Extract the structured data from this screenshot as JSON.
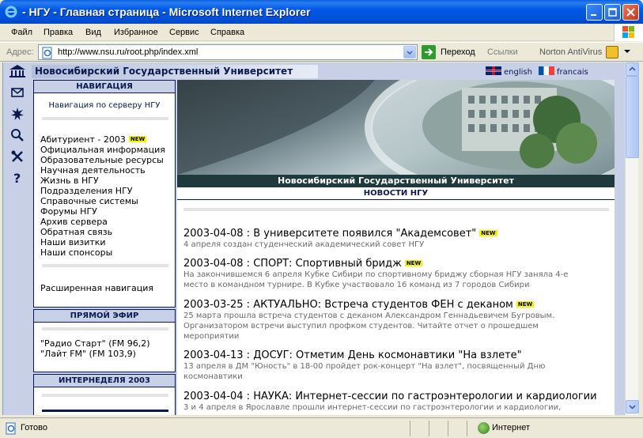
{
  "window": {
    "title": "- НГУ - Главная страница - Microsoft Internet Explorer"
  },
  "menu": [
    "Файл",
    "Правка",
    "Вид",
    "Избранное",
    "Сервис",
    "Справка"
  ],
  "address_bar": {
    "label": "Адрес:",
    "url": "http://www.nsu.ru/root.php/index.xml",
    "go_label": "Переход",
    "links_label": "Ссылки",
    "norton_label": "Norton AntiVirus"
  },
  "site": {
    "title": "Новосибирский Государственный Университет",
    "lang_en": "english",
    "lang_fr": "francais",
    "banner_caption": "Новосибирский Государственный Университет"
  },
  "left_icons": [
    "mail-icon",
    "star-icon",
    "search-icon",
    "tools-icon",
    "help-icon"
  ],
  "navigation": {
    "header": "НАВИГАЦИЯ",
    "subtitle": "Навигация по серверу НГУ",
    "new_badge": "NEW",
    "items": [
      "Абитуриент - 2003",
      "Официальная информация",
      "Образовательные ресурсы",
      "Научная деятельность",
      "Жизнь в НГУ",
      "Подразделения НГУ",
      "Справочные системы",
      "Форумы НГУ",
      "Архив сервера",
      "Обратная связь",
      "Наши визитки",
      "Наши спонсоры"
    ],
    "advanced": "Расширенная навигация"
  },
  "live": {
    "header": "ПРЯМОЙ ЭФИР",
    "items": [
      "\"Радио Старт\" (FM 96,2)",
      "\"Лайт FM\" (FM 103,9)"
    ]
  },
  "internet_week": {
    "header": "ИНТЕРНЕДЕЛЯ 2003"
  },
  "news": {
    "header": "НОВОСТИ НГУ",
    "items": [
      {
        "title": "2003-04-08 : В университете появился \"Академсовет\"",
        "text": "4 апреля создан студенческий академический совет НГУ"
      },
      {
        "title": "2003-04-08 : СПОРТ: Спортивный бридж",
        "text": "На закончившемся 6 апреля Кубке Сибири по спортивному бриджу сборная НГУ заняла 4-е место в командном турнире. В Кубке участвовало 16 команд из 7 городов Сибири"
      },
      {
        "title": "2003-03-25 : АКТУАЛЬНО: Встреча студентов ФЕН с деканом",
        "text": "25 марта прошла встреча студентов с деканом Александром Геннадьевичем Бугровым. Организатором встречи выступил профком студентов. Читайте отчет о прошедшем мероприятии"
      },
      {
        "title": "2003-04-13 : ДОСУГ: Отметим День космонавтики \"На взлете\"",
        "text": "13 апреля в ДМ \"Юность\" в 18-00 пройдет рок-концерт \"На взлет\", посвященный Дню космонавтики"
      },
      {
        "title": "2003-04-04 : НАУКА: Интернет-сессии по гастроэнтерологии и кардиологии",
        "text": "3 и 4 апреля в Ярославле прошли интернет-сессии по гастроэнтерологии и кардиологии,"
      }
    ]
  },
  "status": {
    "text": "Готово",
    "zone": "Интернет"
  }
}
